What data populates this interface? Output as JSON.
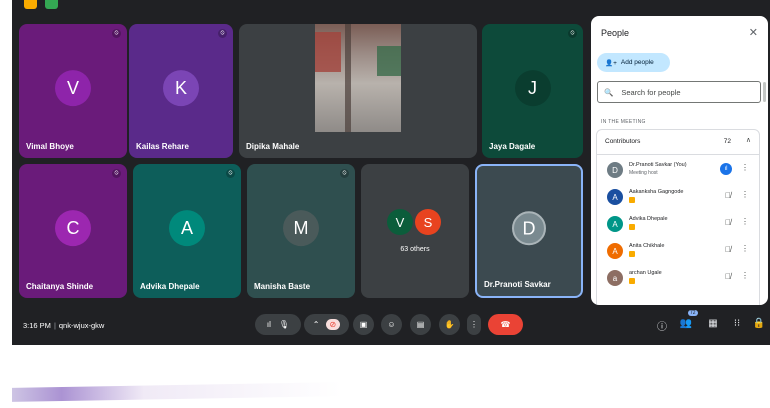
{
  "colors": {
    "background": "#202124",
    "badge_yellow": "#f9ab00",
    "badge_green": "#34a853",
    "leave_red": "#ea4335",
    "selected_tile_border": "#8ab4f8"
  },
  "tiles": [
    {
      "name": "Vimal Bhoye",
      "initial": "V",
      "bg": "#6a1b7a",
      "avatar": "#8e24aa"
    },
    {
      "name": "Kailas Rehare",
      "initial": "K",
      "bg": "#5a2a8a",
      "avatar": "#7b45b5"
    },
    {
      "name": "Dipika Mahale"
    },
    {
      "name": "Jaya Dagale",
      "initial": "J",
      "bg": "#0d4a3a",
      "avatar": "#0a3d2f"
    },
    {
      "name": "Chaitanya Shinde",
      "initial": "C",
      "bg": "#6a1b7a",
      "avatar": "#9c27b0"
    },
    {
      "name": "Advika Dhepale",
      "initial": "A",
      "bg": "#0d5e5a",
      "avatar": "#00897b"
    },
    {
      "name": "Manisha Baste",
      "initial": "M",
      "bg": "#2f4f4f",
      "avatar": "#4a5a5a"
    },
    {
      "name": "Dr.Pranoti Savkar",
      "initial": "D",
      "bg": "#3c4a50",
      "avatar": "#7a8a90"
    }
  ],
  "others_tile": {
    "initials": [
      "V",
      "S"
    ],
    "avatar_colors": [
      "#0b5d3b",
      "#e8431f"
    ],
    "label": "63 others"
  },
  "meeting": {
    "time": "3:16 PM",
    "code": "qnk-wjux-gkw"
  },
  "participant_count_badge": "72",
  "icons": {
    "toolbar_left": [
      "sound-settings-icon",
      "mic-icon"
    ],
    "toolbar_mid": [
      "chevron-up-icon",
      "camera-off-icon",
      "captions-icon",
      "emoji-icon",
      "present-icon",
      "raise-hand-icon",
      "more-options-icon",
      "leave-call-icon"
    ],
    "toolbar_right": [
      "info-icon",
      "people-icon",
      "chat-icon",
      "activities-icon",
      "host-controls-icon"
    ]
  },
  "people_panel": {
    "title": "People",
    "add_people": "Add people",
    "search_placeholder": "Search for people",
    "in_meeting": "IN THE MEETING",
    "group": {
      "label": "Contributors",
      "count": "72",
      "rows": [
        {
          "name": "Dr.Pranoti Savkar (You)",
          "sub": "Meeting host",
          "initial": "D",
          "color": "#6e7c84"
        },
        {
          "name": "Aakanksha Gagngode",
          "initial": "A",
          "color": "#1a4fa0"
        },
        {
          "name": "Advika Dhepale",
          "initial": "A",
          "color": "#009688"
        },
        {
          "name": "Anita Chikhale",
          "initial": "A",
          "color": "#ef6c00"
        },
        {
          "name": "archan Ugale",
          "initial": "a",
          "color": "#8d6e63"
        }
      ]
    }
  }
}
